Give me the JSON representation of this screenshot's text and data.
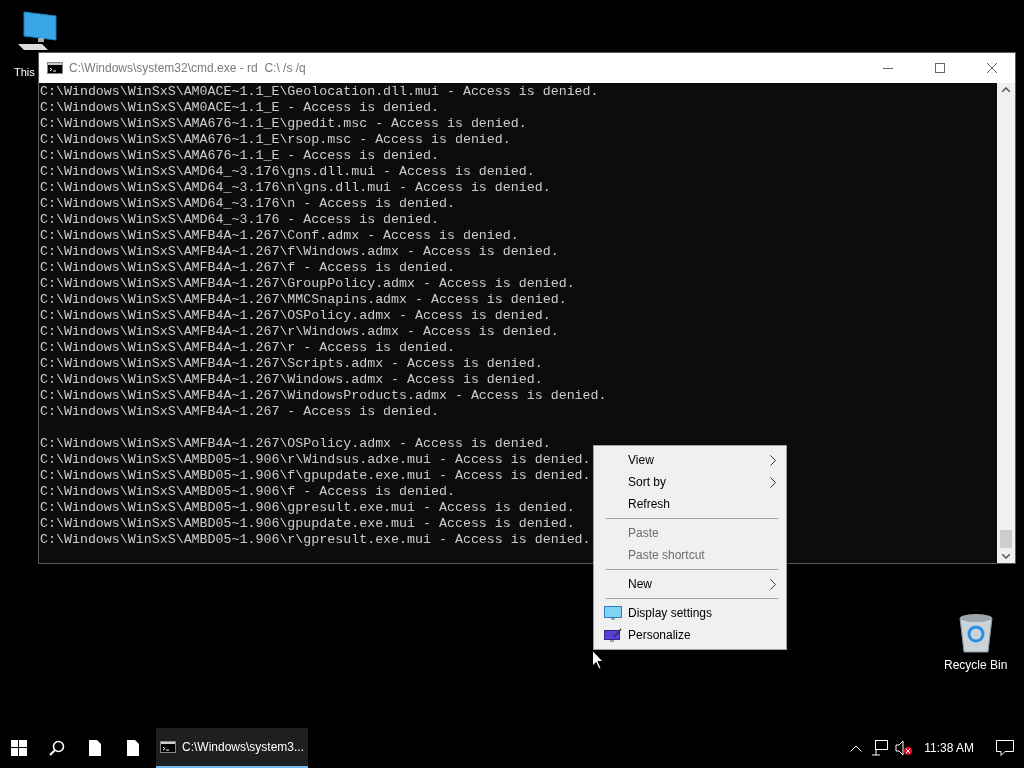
{
  "desktop_icons": [
    {
      "kind": "computer",
      "label": "This"
    },
    {
      "kind": "recycle-bin",
      "label": "Recycle Bin"
    }
  ],
  "window": {
    "title": "C:\\Windows\\system32\\cmd.exe - rd  C:\\ /s /q"
  },
  "console": {
    "blocks": [
      [
        "C:\\Windows\\WinSxS\\AM0ACE~1.1_E\\Geolocation.dll.mui - Access is denied.",
        "C:\\Windows\\WinSxS\\AM0ACE~1.1_E - Access is denied.",
        "C:\\Windows\\WinSxS\\AMA676~1.1_E\\gpedit.msc - Access is denied.",
        "C:\\Windows\\WinSxS\\AMA676~1.1_E\\rsop.msc - Access is denied.",
        "C:\\Windows\\WinSxS\\AMA676~1.1_E - Access is denied.",
        "C:\\Windows\\WinSxS\\AMD64_~3.176\\gns.dll.mui - Access is denied.",
        "C:\\Windows\\WinSxS\\AMD64_~3.176\\n\\gns.dll.mui - Access is denied.",
        "C:\\Windows\\WinSxS\\AMD64_~3.176\\n - Access is denied.",
        "C:\\Windows\\WinSxS\\AMD64_~3.176 - Access is denied.",
        "C:\\Windows\\WinSxS\\AMFB4A~1.267\\Conf.admx - Access is denied.",
        "C:\\Windows\\WinSxS\\AMFB4A~1.267\\f\\Windows.admx - Access is denied.",
        "C:\\Windows\\WinSxS\\AMFB4A~1.267\\f - Access is denied.",
        "C:\\Windows\\WinSxS\\AMFB4A~1.267\\GroupPolicy.admx - Access is denied.",
        "C:\\Windows\\WinSxS\\AMFB4A~1.267\\MMCSnapins.admx - Access is denied.",
        "C:\\Windows\\WinSxS\\AMFB4A~1.267\\OSPolicy.admx - Access is denied.",
        "C:\\Windows\\WinSxS\\AMFB4A~1.267\\r\\Windows.admx - Access is denied.",
        "C:\\Windows\\WinSxS\\AMFB4A~1.267\\r - Access is denied.",
        "C:\\Windows\\WinSxS\\AMFB4A~1.267\\Scripts.admx - Access is denied.",
        "C:\\Windows\\WinSxS\\AMFB4A~1.267\\Windows.admx - Access is denied.",
        "C:\\Windows\\WinSxS\\AMFB4A~1.267\\WindowsProducts.admx - Access is denied.",
        "C:\\Windows\\WinSxS\\AMFB4A~1.267 - Access is denied."
      ],
      [
        "C:\\Windows\\WinSxS\\AMFB4A~1.267\\OSPolicy.admx - Access is denied.",
        "C:\\Windows\\WinSxS\\AMBD05~1.906\\r\\Windsus.adxe.mui - Access is denied.",
        "C:\\Windows\\WinSxS\\AMBD05~1.906\\f\\gpupdate.exe.mui - Access is denied.",
        "C:\\Windows\\WinSxS\\AMBD05~1.906\\f - Access is denied.",
        "C:\\Windows\\WinSxS\\AMBD05~1.906\\gpresult.exe.mui - Access is denied.",
        "C:\\Windows\\WinSxS\\AMBD05~1.906\\gpupdate.exe.mui - Access is denied.",
        "C:\\Windows\\WinSxS\\AMBD05~1.906\\r\\gpresult.exe.mui - Access is denied."
      ]
    ]
  },
  "context_menu": {
    "items": [
      {
        "kind": "submenu",
        "label": "View",
        "disabled": false
      },
      {
        "kind": "submenu",
        "label": "Sort by",
        "disabled": false
      },
      {
        "kind": "plain",
        "label": "Refresh",
        "disabled": false
      },
      {
        "kind": "separator"
      },
      {
        "kind": "plain",
        "label": "Paste",
        "disabled": true
      },
      {
        "kind": "plain",
        "label": "Paste shortcut",
        "disabled": true
      },
      {
        "kind": "separator"
      },
      {
        "kind": "submenu",
        "label": "New",
        "disabled": false
      },
      {
        "kind": "separator"
      },
      {
        "kind": "display",
        "label": "Display settings",
        "disabled": false
      },
      {
        "kind": "personalize",
        "label": "Personalize",
        "disabled": false
      }
    ]
  },
  "taskbar": {
    "task": {
      "label": "C:\\Windows\\system3...",
      "active": true
    },
    "clock": "11:38 AM"
  }
}
